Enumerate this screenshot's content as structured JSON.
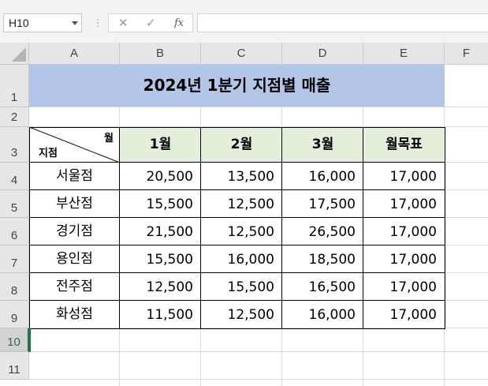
{
  "formula_bar": {
    "name_box": "H10",
    "cancel_icon": "✕",
    "enter_icon": "✓",
    "fx_label": "fx",
    "formula": ""
  },
  "columns": [
    "A",
    "B",
    "C",
    "D",
    "E",
    "F"
  ],
  "rows": [
    "1",
    "2",
    "3",
    "4",
    "5",
    "6",
    "7",
    "8",
    "9",
    "10",
    "11"
  ],
  "selected_row": "10",
  "sheet": {
    "title": "2024년 1분기 지점별 매출",
    "header_corner": {
      "top_label": "월",
      "bottom_label": "지점"
    },
    "headers": [
      "1월",
      "2월",
      "3월",
      "월목표"
    ],
    "branches": [
      {
        "name": "서울점",
        "values": [
          "20,500",
          "13,500",
          "16,000",
          "17,000"
        ]
      },
      {
        "name": "부산점",
        "values": [
          "15,500",
          "12,500",
          "17,500",
          "17,000"
        ]
      },
      {
        "name": "경기점",
        "values": [
          "21,500",
          "12,500",
          "26,500",
          "17,000"
        ]
      },
      {
        "name": "용인점",
        "values": [
          "15,500",
          "16,000",
          "18,500",
          "17,000"
        ]
      },
      {
        "name": "전주점",
        "values": [
          "12,500",
          "15,500",
          "16,500",
          "17,000"
        ]
      },
      {
        "name": "화성점",
        "values": [
          "11,500",
          "12,500",
          "16,000",
          "17,000"
        ]
      }
    ]
  },
  "colors": {
    "title_fill": "#b4c6e7",
    "header_fill": "#e2efda",
    "selection": "#217346"
  }
}
